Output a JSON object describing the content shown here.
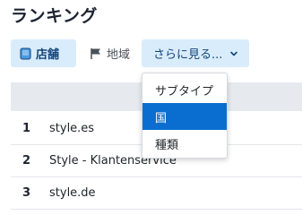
{
  "page": {
    "title": "ランキング"
  },
  "tabs": {
    "stores": {
      "label": "店舗",
      "icon": "store-icon"
    },
    "region": {
      "label": "地域",
      "icon": "flag-icon"
    },
    "more": {
      "label": "さらに見る...",
      "icon": "chevron-down-icon"
    }
  },
  "dropdown": {
    "items": [
      {
        "label": "サブタイプ",
        "selected": false
      },
      {
        "label": "国",
        "selected": true
      },
      {
        "label": "種類",
        "selected": false
      }
    ]
  },
  "table": {
    "rows": [
      {
        "rank": "1",
        "name": "style.es"
      },
      {
        "rank": "2",
        "name": "Style - Klantenservice"
      },
      {
        "rank": "3",
        "name": "style.de"
      }
    ]
  },
  "colors": {
    "accent": "#0a6ed1",
    "tab_active_bg": "#d9ecfb",
    "tab_active_text": "#14457a",
    "header_bg": "#e6eaee"
  }
}
